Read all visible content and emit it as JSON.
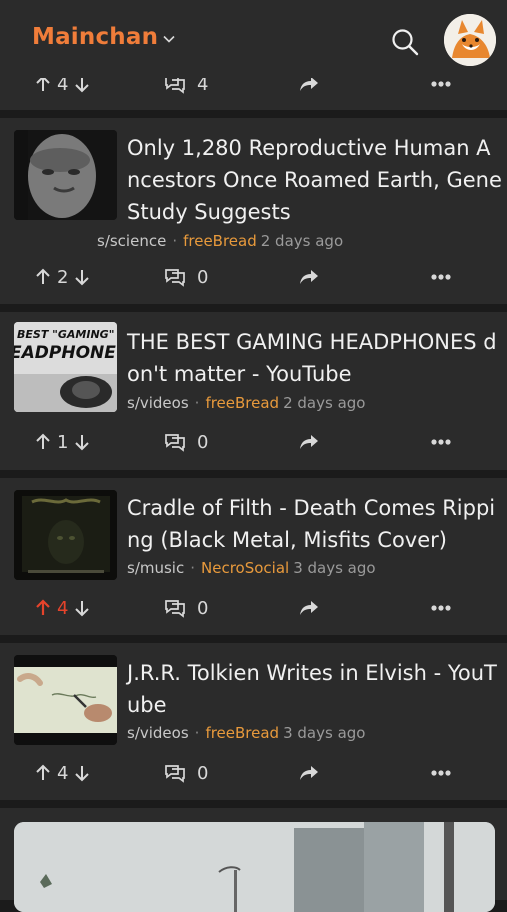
{
  "app": {
    "title": "Mainchan"
  },
  "top_partial_card": {
    "upvotes": "4",
    "comments": "4"
  },
  "posts": [
    {
      "title": "Only 1,280 Reproductive Human Ancestors Once Roamed Earth, Gene Study Suggests",
      "community": "s/science",
      "user": "freeBread",
      "time": "2 days ago",
      "upvotes": "2",
      "comments": "0",
      "thumbnail": "face-photo",
      "upvoted": false
    },
    {
      "title": "THE BEST GAMING HEADPHONES don't matter - YouTube",
      "community": "s/videos",
      "user": "freeBread",
      "time": "2 days ago",
      "upvotes": "1",
      "comments": "0",
      "thumbnail": "headphones-video",
      "thumb_text_1": "BEST \"GAMING\"",
      "thumb_text_2": "EADPHONE",
      "upvoted": false
    },
    {
      "title": "Cradle of Filth - Death Comes Ripping (Black Metal, Misfits Cover)",
      "community": "s/music",
      "user": "NecroSocial",
      "time": "3 days ago",
      "upvotes": "4",
      "comments": "0",
      "thumbnail": "album-cover",
      "upvoted": true
    },
    {
      "title": "J.R.R. Tolkien Writes in Elvish - YouTube",
      "community": "s/videos",
      "user": "freeBread",
      "time": "3 days ago",
      "upvotes": "4",
      "comments": "0",
      "thumbnail": "handwriting-video",
      "upvoted": false
    }
  ],
  "colors": {
    "accent": "#f07d3a",
    "user": "#e89a3c",
    "upvote_active": "#e5432b",
    "card_bg": "#2b2b2b",
    "page_bg": "#1b1b1b"
  }
}
